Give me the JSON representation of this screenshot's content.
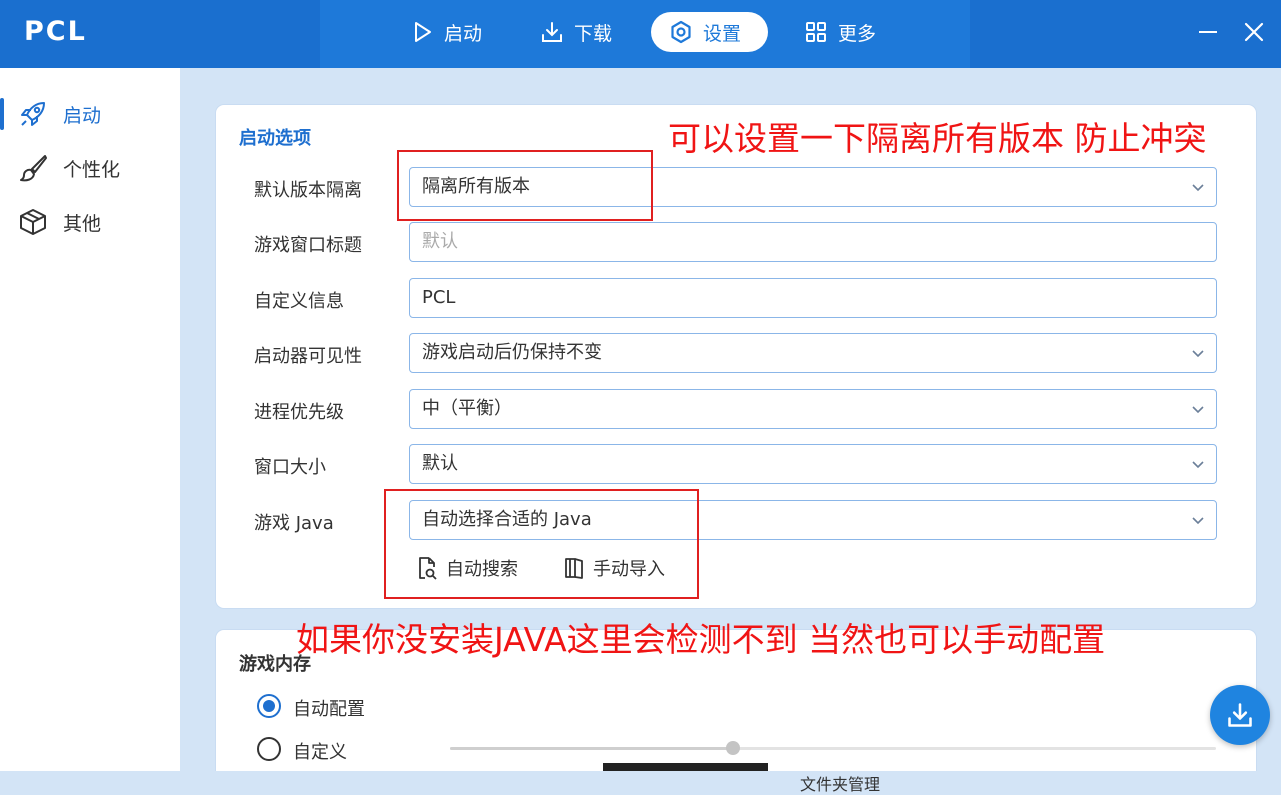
{
  "app": {
    "name": "PCL"
  },
  "nav": {
    "items": [
      {
        "label": "启动",
        "icon": "play-icon"
      },
      {
        "label": "下载",
        "icon": "download-icon"
      },
      {
        "label": "设置",
        "icon": "gear-icon",
        "active": true
      },
      {
        "label": "更多",
        "icon": "grid-icon"
      }
    ]
  },
  "window": {
    "minimize_icon": "minimize-icon",
    "close_icon": "close-icon"
  },
  "sidebar": {
    "items": [
      {
        "label": "启动",
        "icon": "rocket-icon",
        "active": true
      },
      {
        "label": "个性化",
        "icon": "brush-icon"
      },
      {
        "label": "其他",
        "icon": "box-icon"
      }
    ]
  },
  "launch_options": {
    "title": "启动选项",
    "rows": [
      {
        "label": "默认版本隔离",
        "value": "隔离所有版本",
        "type": "select"
      },
      {
        "label": "游戏窗口标题",
        "placeholder": "默认",
        "type": "text"
      },
      {
        "label": "自定义信息",
        "value": "PCL",
        "type": "text"
      },
      {
        "label": "启动器可见性",
        "value": "游戏启动后仍保持不变",
        "type": "select"
      },
      {
        "label": "进程优先级",
        "value": "中（平衡）",
        "type": "select"
      },
      {
        "label": "窗口大小",
        "value": "默认",
        "type": "select"
      },
      {
        "label": "游戏 Java",
        "value": "自动选择合适的 Java",
        "type": "select"
      }
    ],
    "auto_search_label": "自动搜索",
    "manual_import_label": "手动导入"
  },
  "game_memory": {
    "title": "游戏内存",
    "options": [
      {
        "label": "自动配置",
        "selected": true
      },
      {
        "label": "自定义",
        "selected": false
      }
    ],
    "slider_value": 0.37
  },
  "annotations": {
    "top_note": "可以设置一下隔离所有版本 防止冲突",
    "java_note": "如果你没安装JAVA这里会检测不到 当然也可以手动配置"
  },
  "fab": {
    "icon": "download-icon"
  },
  "bottom": {
    "partial_text": "文件夹管理"
  },
  "colors": {
    "accent": "#1e6fcf",
    "titlebar": "#1a6fcf",
    "annotation": "#f01414"
  }
}
